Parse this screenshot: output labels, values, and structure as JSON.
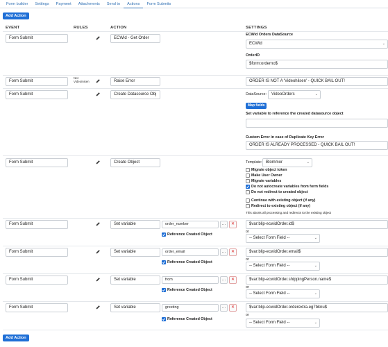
{
  "tabs": [
    "Form builder",
    "Settings",
    "Payment",
    "Attachments",
    "Send to",
    "Actions",
    "Form Submits"
  ],
  "active_tab": "Actions",
  "add_action_label": "Add Action",
  "headers": {
    "event": "EVENT",
    "rules": "RULES",
    "action": "ACTION",
    "settings": "SETTINGS"
  },
  "rows": [
    {
      "event": "Form Submit",
      "rule": "",
      "action": "ECWid - Get Order",
      "ds_label": "ECWid Orders DataSource",
      "ds_value": "ECWid",
      "orderid_label": "OrderID",
      "orderid_value": "$form:orderno$"
    },
    {
      "event": "Form Submit",
      "rule": "Not Videoinisen",
      "action": "Raise Error",
      "message": "ORDER IS NOT A 'Videohilsen' - QUICK BAIL OUT!"
    },
    {
      "event": "Form Submit",
      "rule": "",
      "action": "Create Datasource Obj",
      "datasource_label": "DataSource:",
      "datasource_value": "VideoOrders",
      "map_fields": "Map fields",
      "ref_var_label": "Set variable to reference the created datasource object",
      "dup_label": "Custom Error in case of Duplicate Key Error",
      "dup_value": "ORDER IS ALREADY PROCESSED - QUICK BAIL OUT!"
    },
    {
      "event": "Form Submit",
      "rule": "",
      "action": "Create Object",
      "template_label": "Template:",
      "template_value": "Blommor",
      "options": [
        {
          "label": "Migrate object token",
          "checked": false
        },
        {
          "label": "Make User Owner",
          "checked": false
        },
        {
          "label": "Migrate variables",
          "checked": false
        },
        {
          "label": "Do not autocreate variables from form fields",
          "checked": true
        },
        {
          "label": "Do not redirect to created object",
          "checked": false
        }
      ],
      "options2": [
        {
          "label": "Continue with existing object (if any)",
          "checked": false
        },
        {
          "label": "Redirect to existing object (if any)",
          "checked": false
        }
      ],
      "note": "This aborts all processing and redirects to the existing object"
    }
  ],
  "set_vars": [
    {
      "event": "Form Submit",
      "action": "Set variable",
      "name": "order_number",
      "value": "$var:blip-ecwidOrder.id$"
    },
    {
      "event": "Form Submit",
      "action": "Set variable",
      "name": "order_email",
      "value": "$var:blip-ecwidOrder.email$"
    },
    {
      "event": "Form Submit",
      "action": "Set variable",
      "name": "from",
      "value": "$var:blip-ecwidOrder.shippingPerson.name$"
    },
    {
      "event": "Form Submit",
      "action": "Set variable",
      "name": "greeting",
      "value": "$var:blip-ecwidOrder.orderextra.eg7bknu$"
    }
  ],
  "ref_created_label": "Reference Created Object",
  "or_label": "or",
  "select_field": "-- Select Form Field --",
  "colors": {
    "accent": "#1f6fd6",
    "tab_link": "#2f6fb3",
    "danger": "#dd2222"
  }
}
